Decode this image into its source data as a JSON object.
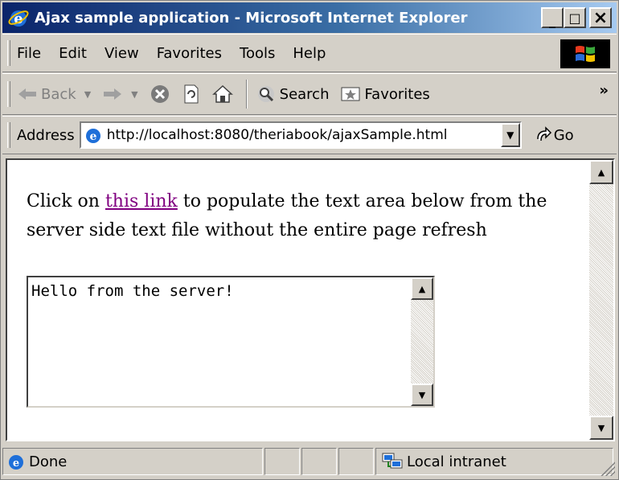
{
  "window": {
    "title": "Ajax sample application - Microsoft Internet Explorer",
    "caption_buttons": [
      {
        "name": "minimize",
        "glyph": "_"
      },
      {
        "name": "maximize",
        "glyph": "□"
      },
      {
        "name": "close",
        "glyph": "×"
      }
    ]
  },
  "menubar": {
    "items": [
      {
        "label": "File",
        "accel": "F"
      },
      {
        "label": "Edit",
        "accel": "E"
      },
      {
        "label": "View",
        "accel": "V"
      },
      {
        "label": "Favorites",
        "accel": "a"
      },
      {
        "label": "Tools",
        "accel": "T"
      },
      {
        "label": "Help",
        "accel": "H"
      }
    ]
  },
  "toolbar": {
    "back_label": "Back",
    "search_label": "Search",
    "favorites_label": "Favorites",
    "chevron": "»"
  },
  "addressbar": {
    "label": "Address",
    "url": "http://localhost:8080/theriabook/ajaxSample.html",
    "go_label": "Go"
  },
  "page": {
    "text_before_link": "Click on ",
    "link_text": "this link",
    "text_after_link": " to populate the text area below from the server side text file without the entire page refresh",
    "textarea_value": "Hello from the server!",
    "link_color": "#800080"
  },
  "statusbar": {
    "status_text": "Done",
    "zone_text": "Local intranet"
  },
  "colors": {
    "title_gradient_start": "#0a246a",
    "title_gradient_end": "#a6caf0",
    "chrome": "#d4d0c8"
  }
}
